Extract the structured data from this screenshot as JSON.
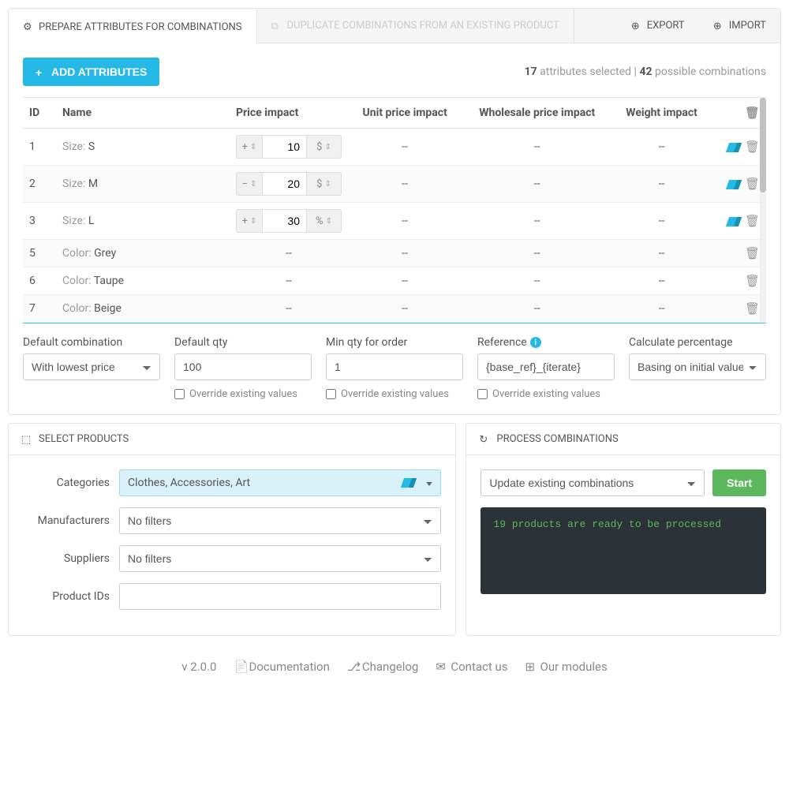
{
  "tabs": {
    "prepare": "Prepare attributes for combinations",
    "duplicate": "Duplicate combinations from an existing product",
    "export": "Export",
    "import": "Import"
  },
  "toolbar": {
    "add_btn": "Add attributes",
    "attrs_count": "17",
    "attrs_label": "attributes selected",
    "sep": " | ",
    "combos_count": "42",
    "combos_label": "possible combinations"
  },
  "table": {
    "headers": {
      "id": "ID",
      "name": "Name",
      "price": "Price impact",
      "unit": "Unit price impact",
      "wholesale": "Wholesale price impact",
      "weight": "Weight impact"
    },
    "rows": [
      {
        "id": "1",
        "group": "Size:",
        "val": "S",
        "sign": "+",
        "num": "10",
        "unit": "$",
        "erase": true
      },
      {
        "id": "2",
        "group": "Size:",
        "val": "M",
        "sign": "−",
        "num": "20",
        "unit": "$",
        "erase": true
      },
      {
        "id": "3",
        "group": "Size:",
        "val": "L",
        "sign": "+",
        "num": "30",
        "unit": "%",
        "erase": true
      },
      {
        "id": "5",
        "group": "Color:",
        "val": "Grey",
        "sign": "",
        "num": "",
        "unit": "",
        "erase": false
      },
      {
        "id": "6",
        "group": "Color:",
        "val": "Taupe",
        "sign": "",
        "num": "",
        "unit": "",
        "erase": false
      },
      {
        "id": "7",
        "group": "Color:",
        "val": "Beige",
        "sign": "",
        "num": "",
        "unit": "",
        "erase": false
      }
    ]
  },
  "defaults": {
    "combo_label": "Default combination",
    "combo_val": "With lowest price",
    "qty_label": "Default qty",
    "qty_val": "100",
    "min_label": "Min qty for order",
    "min_val": "1",
    "ref_label": "Reference",
    "ref_val": "{base_ref}_{iterate}",
    "pct_label": "Calculate percentage",
    "pct_val": "Basing on initial value",
    "override": "Override existing values"
  },
  "select_products": {
    "title": "Select products",
    "cat_label": "Categories",
    "cat_val": "Clothes, Accessories, Art",
    "manu_label": "Manufacturers",
    "manu_val": "No filters",
    "supp_label": "Suppliers",
    "supp_val": "No filters",
    "pid_label": "Product IDs"
  },
  "process": {
    "title": "Process combinations",
    "mode": "Update existing combinations",
    "start": "Start",
    "console": "19 products are ready to be processed"
  },
  "footer": {
    "version": "v 2.0.0",
    "doc": "Documentation",
    "changelog": "Changelog",
    "contact": "Contact us",
    "modules": "Our modules"
  }
}
